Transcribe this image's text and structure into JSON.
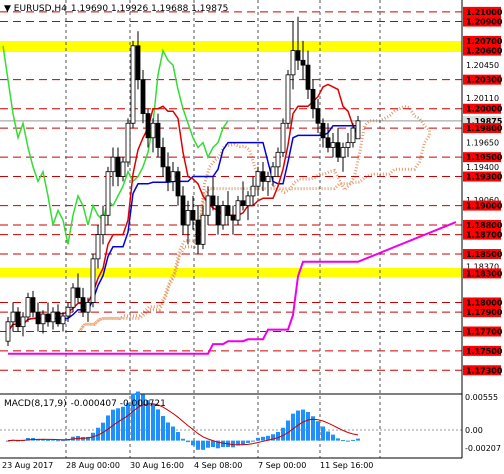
{
  "symbol": {
    "pair": "EURUSD,H4",
    "values": "1.19690 1.19926 1.19688 1.19875"
  },
  "macd": {
    "title": "MACD(8,17,9)",
    "values": "-0.000407 -0.000721",
    "scale_top": "0.00555",
    "scale_zero": "0.00",
    "scale_bottom": "-0.00207"
  },
  "price_labels": [
    {
      "text": "1.21000",
      "style": "red"
    },
    {
      "text": "1.20900",
      "style": "red"
    },
    {
      "text": "1.20700",
      "style": "yellow"
    },
    {
      "text": "1.20600",
      "style": "yellow"
    },
    {
      "text": "1.20450",
      "style": "plain"
    },
    {
      "text": "1.20300",
      "style": "red"
    },
    {
      "text": "1.20110",
      "style": "plain"
    },
    {
      "text": "1.20000",
      "style": "red"
    },
    {
      "text": "1.19875",
      "style": "current"
    },
    {
      "text": "1.19800",
      "style": "red"
    },
    {
      "text": "1.19650",
      "style": "plain"
    },
    {
      "text": "1.19500",
      "style": "red"
    },
    {
      "text": "1.19400",
      "style": "plain"
    },
    {
      "text": "1.19300",
      "style": "red"
    },
    {
      "text": "1.19060",
      "style": "plain"
    },
    {
      "text": "1.19000",
      "style": "red"
    },
    {
      "text": "1.18800",
      "style": "red"
    },
    {
      "text": "1.18700",
      "style": "red"
    },
    {
      "text": "1.18500",
      "style": "red"
    },
    {
      "text": "1.18370",
      "style": "plain"
    },
    {
      "text": "1.18300",
      "style": "yellow"
    },
    {
      "text": "1.18000",
      "style": "red"
    },
    {
      "text": "1.17900",
      "style": "red"
    },
    {
      "text": "1.17700",
      "style": "red"
    },
    {
      "text": "1.17500",
      "style": "red"
    },
    {
      "text": "1.17300",
      "style": "red"
    }
  ],
  "date_labels": [
    "23 Aug 2017",
    "28 Aug 00:00",
    "30 Aug 16:00",
    "4 Sep 08:00",
    "7 Sep 00:00",
    "11 Sep 16:00"
  ],
  "chart_data": {
    "type": "candlestick",
    "symbol": "EURUSD",
    "timeframe": "H4",
    "ohlc_last": {
      "open": 1.1969,
      "high": 1.19926,
      "low": 1.19688,
      "close": 1.19875
    },
    "yellow_zones": [
      [
        1.206,
        1.207
      ],
      [
        1.183,
        1.1838
      ]
    ],
    "red_levels": [
      1.21,
      1.209,
      1.203,
      1.2,
      1.198,
      1.195,
      1.193,
      1.19,
      1.188,
      1.187,
      1.185,
      1.18,
      1.179,
      1.177,
      1.175,
      1.173
    ],
    "candles": [
      [
        1.176,
        1.1785,
        1.1755,
        1.178
      ],
      [
        1.178,
        1.18,
        1.177,
        1.179
      ],
      [
        1.179,
        1.1795,
        1.177,
        1.1775
      ],
      [
        1.1775,
        1.179,
        1.1765,
        1.1785
      ],
      [
        1.1785,
        1.181,
        1.178,
        1.1805
      ],
      [
        1.1805,
        1.1812,
        1.1785,
        1.179
      ],
      [
        1.179,
        1.18,
        1.177,
        1.1778
      ],
      [
        1.1778,
        1.1792,
        1.1768,
        1.1788
      ],
      [
        1.1788,
        1.18,
        1.1775,
        1.178
      ],
      [
        1.178,
        1.1795,
        1.1772,
        1.179
      ],
      [
        1.179,
        1.1798,
        1.1775,
        1.1778
      ],
      [
        1.1778,
        1.179,
        1.177,
        1.1786
      ],
      [
        1.1786,
        1.18,
        1.178,
        1.1795
      ],
      [
        1.1795,
        1.182,
        1.179,
        1.1815
      ],
      [
        1.1815,
        1.183,
        1.18,
        1.1805
      ],
      [
        1.1805,
        1.1815,
        1.1785,
        1.179
      ],
      [
        1.179,
        1.1805,
        1.178,
        1.18
      ],
      [
        1.18,
        1.185,
        1.1795,
        1.1845
      ],
      [
        1.1845,
        1.188,
        1.1835,
        1.187
      ],
      [
        1.187,
        1.19,
        1.186,
        1.189
      ],
      [
        1.189,
        1.194,
        1.188,
        1.1935
      ],
      [
        1.1935,
        1.196,
        1.192,
        1.195
      ],
      [
        1.195,
        1.196,
        1.192,
        1.193
      ],
      [
        1.193,
        1.195,
        1.1925,
        1.1945
      ],
      [
        1.1945,
        1.199,
        1.194,
        1.1985
      ],
      [
        1.1985,
        1.207,
        1.198,
        1.2065
      ],
      [
        1.2065,
        1.208,
        1.202,
        1.203
      ],
      [
        1.203,
        1.204,
        1.1985,
        1.1995
      ],
      [
        1.1995,
        1.2,
        1.196,
        1.197
      ],
      [
        1.197,
        1.199,
        1.1955,
        1.1985
      ],
      [
        1.1985,
        1.1995,
        1.195,
        1.196
      ],
      [
        1.196,
        1.197,
        1.193,
        1.194
      ],
      [
        1.194,
        1.1955,
        1.1915,
        1.1925
      ],
      [
        1.1925,
        1.1945,
        1.1915,
        1.1935
      ],
      [
        1.1935,
        1.194,
        1.19,
        1.191
      ],
      [
        1.191,
        1.192,
        1.187,
        1.188
      ],
      [
        1.188,
        1.1905,
        1.186,
        1.1895
      ],
      [
        1.1895,
        1.191,
        1.1875,
        1.1885
      ],
      [
        1.1885,
        1.19,
        1.185,
        1.186
      ],
      [
        1.186,
        1.19,
        1.1855,
        1.189
      ],
      [
        1.189,
        1.192,
        1.188,
        1.191
      ],
      [
        1.191,
        1.193,
        1.1895,
        1.19
      ],
      [
        1.19,
        1.191,
        1.187,
        1.188
      ],
      [
        1.188,
        1.1905,
        1.1875,
        1.19
      ],
      [
        1.19,
        1.1915,
        1.188,
        1.189
      ],
      [
        1.189,
        1.19,
        1.187,
        1.1885
      ],
      [
        1.1885,
        1.191,
        1.188,
        1.1905
      ],
      [
        1.1905,
        1.1925,
        1.1895,
        1.19
      ],
      [
        1.19,
        1.1915,
        1.1885,
        1.191
      ],
      [
        1.191,
        1.193,
        1.19,
        1.192
      ],
      [
        1.192,
        1.194,
        1.191,
        1.1935
      ],
      [
        1.1935,
        1.1945,
        1.1915,
        1.1925
      ],
      [
        1.1925,
        1.1935,
        1.191,
        1.193
      ],
      [
        1.193,
        1.1945,
        1.192,
        1.194
      ],
      [
        1.194,
        1.196,
        1.193,
        1.1955
      ],
      [
        1.1955,
        1.199,
        1.195,
        1.1985
      ],
      [
        1.1985,
        1.204,
        1.198,
        1.2035
      ],
      [
        1.2035,
        1.209,
        1.202,
        1.206
      ],
      [
        1.206,
        1.2095,
        1.204,
        1.205
      ],
      [
        1.205,
        1.207,
        1.203,
        1.2045
      ],
      [
        1.2045,
        1.206,
        1.201,
        1.202
      ],
      [
        1.202,
        1.203,
        1.199,
        1.2
      ],
      [
        1.2,
        1.201,
        1.1975,
        1.1985
      ],
      [
        1.1985,
        1.199,
        1.196,
        1.197
      ],
      [
        1.197,
        1.1985,
        1.1955,
        1.196
      ],
      [
        1.196,
        1.1975,
        1.195,
        1.1965
      ],
      [
        1.1965,
        1.198,
        1.1945,
        1.195
      ],
      [
        1.195,
        1.1965,
        1.1935,
        1.196
      ],
      [
        1.196,
        1.1975,
        1.195,
        1.1965
      ],
      [
        1.1965,
        1.1985,
        1.196,
        1.198
      ],
      [
        1.1969,
        1.19926,
        1.19688,
        1.19875
      ]
    ],
    "indicators": {
      "macd_scale": [
        -0.00207,
        0.00555
      ],
      "series": [
        "lime_line",
        "red_line",
        "blue_line",
        "magenta_line",
        "dotted_cloud",
        "macd_histogram",
        "macd_signal"
      ]
    }
  }
}
